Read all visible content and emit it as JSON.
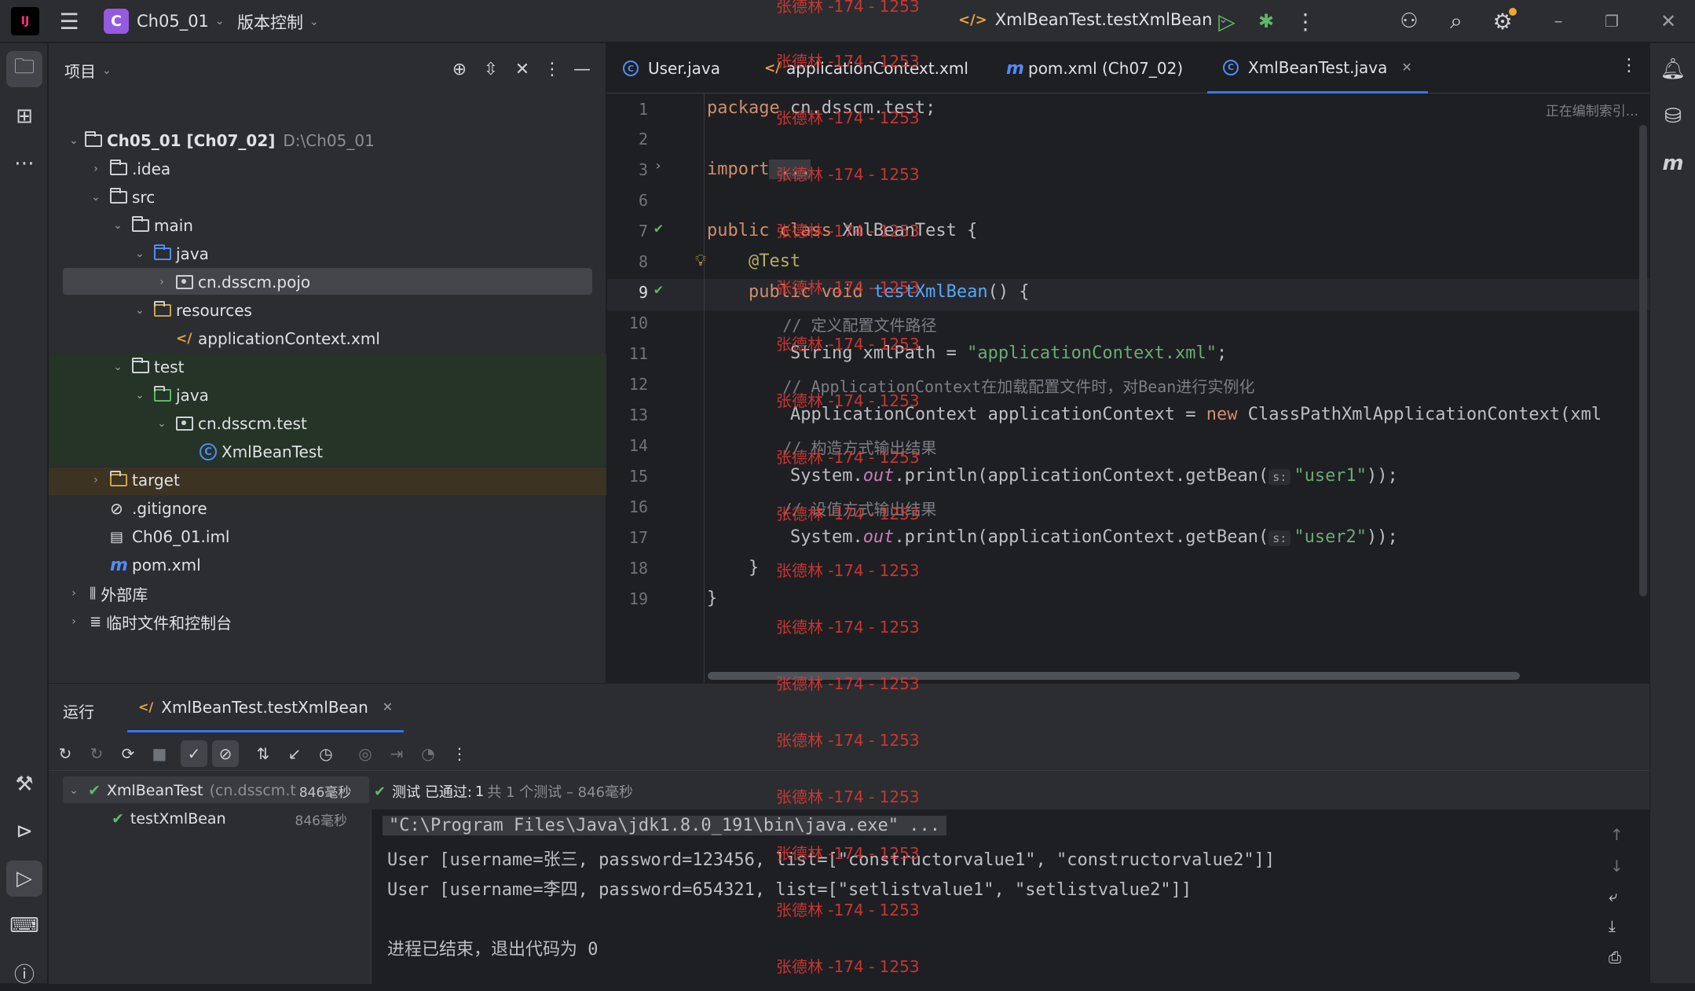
{
  "titlebar": {
    "logo_text": "IJ",
    "project_badge": "C",
    "project_name": "Ch05_01",
    "vcs_label": "版本控制",
    "run_config": "XmlBeanTest.testXmlBean"
  },
  "project_panel": {
    "title": "项目",
    "tree": [
      {
        "label": "Ch05_01 [Ch07_02]",
        "extra": "D:\\Ch05_01",
        "icon": "module-folder-icon"
      },
      {
        "label": ".idea",
        "icon": "folder-icon"
      },
      {
        "label": "src",
        "icon": "folder-icon"
      },
      {
        "label": "main",
        "icon": "folder-icon"
      },
      {
        "label": "java",
        "icon": "source-folder-icon"
      },
      {
        "label": "cn.dsscm.pojo",
        "icon": "package-icon"
      },
      {
        "label": "resources",
        "icon": "resources-folder-icon"
      },
      {
        "label": "applicationContext.xml",
        "icon": "xml-file-icon"
      },
      {
        "label": "test",
        "icon": "folder-icon"
      },
      {
        "label": "java",
        "icon": "test-source-folder-icon"
      },
      {
        "label": "cn.dsscm.test",
        "icon": "package-icon"
      },
      {
        "label": "XmlBeanTest",
        "icon": "class-icon"
      },
      {
        "label": "target",
        "icon": "folder-icon"
      },
      {
        "label": ".gitignore",
        "icon": "ignore-file-icon"
      },
      {
        "label": "Ch06_01.iml",
        "icon": "iml-file-icon"
      },
      {
        "label": "pom.xml",
        "icon": "maven-icon"
      },
      {
        "label": "外部库",
        "icon": "library-icon"
      },
      {
        "label": "临时文件和控制台",
        "icon": "scratch-icon"
      }
    ]
  },
  "editor": {
    "tabs": [
      {
        "label": "User.java",
        "icon": "class-icon"
      },
      {
        "label": "applicationContext.xml",
        "icon": "xml-file-icon"
      },
      {
        "label": "pom.xml (Ch07_02)",
        "icon": "maven-icon"
      },
      {
        "label": "XmlBeanTest.java",
        "icon": "class-icon",
        "active": true
      }
    ],
    "indexing_status": "正在编制索引...",
    "line_numbers": [
      "1",
      "2",
      "3",
      "6",
      "7",
      "8",
      "9",
      "10",
      "11",
      "12",
      "13",
      "14",
      "15",
      "16",
      "17",
      "18",
      "19"
    ],
    "code": {
      "l1_kw": "package",
      "l1_rest": " cn.dsscm.test;",
      "l3_kw": "import",
      "l3_rest": " ...",
      "l7_kw": "public class",
      "l7_rest": " XmlBeanTest {",
      "l8": "@Test",
      "l9_kw": "public void",
      "l9_fn": "testXmlBean",
      "l9_rest": "() {",
      "l10": "// 定义配置文件路径",
      "l11_a": "String xmlPath = ",
      "l11_str": "\"applicationContext.xml\"",
      "l11_b": ";",
      "l12": "// ApplicationContext在加载配置文件时，对Bean进行实例化",
      "l13_a": "ApplicationContext applicationContext = ",
      "l13_kw": "new",
      "l13_b": " ClassPathXmlApplicationContext(xml",
      "l14": "// 构造方式输出结果",
      "l15_a": "System.",
      "l15_out": "out",
      "l15_b": ".println(applicationContext.getBean(",
      "l15_hint": "s:",
      "l15_str": "\"user1\"",
      "l15_c": "));",
      "l16": "// 设值方式输出结果",
      "l17_a": "System.",
      "l17_out": "out",
      "l17_b": ".println(applicationContext.getBean(",
      "l17_hint": "s:",
      "l17_str": "\"user2\"",
      "l17_c": "));",
      "l18": "}",
      "l19": "}"
    }
  },
  "run_panel": {
    "title": "运行",
    "tab_label": "XmlBeanTest.testXmlBean",
    "tree": [
      {
        "label": "XmlBeanTest",
        "pkg": "(cn.dsscm.t",
        "time": "846毫秒"
      },
      {
        "label": "testXmlBean",
        "time": "846毫秒"
      }
    ],
    "status_prefix": "测试 已通过:",
    "status_count": "1",
    "status_suffix": "共 1 个测试 – 846毫秒",
    "console": [
      "\"C:\\Program Files\\Java\\jdk1.8.0_191\\bin\\java.exe\" ...",
      "User [username=张三, password=123456, list=[\"constructorvalue1\", \"constructorvalue2\"]]",
      "User [username=李四, password=654321, list=[\"setlistvalue1\", \"setlistvalue2\"]]",
      "",
      "进程已结束，退出代码为 0"
    ]
  },
  "watermark": "张德林 -174 - 1253",
  "colors": {
    "accent": "#3574f0",
    "pass_green": "#5fb865",
    "watermark": "#e53935"
  }
}
